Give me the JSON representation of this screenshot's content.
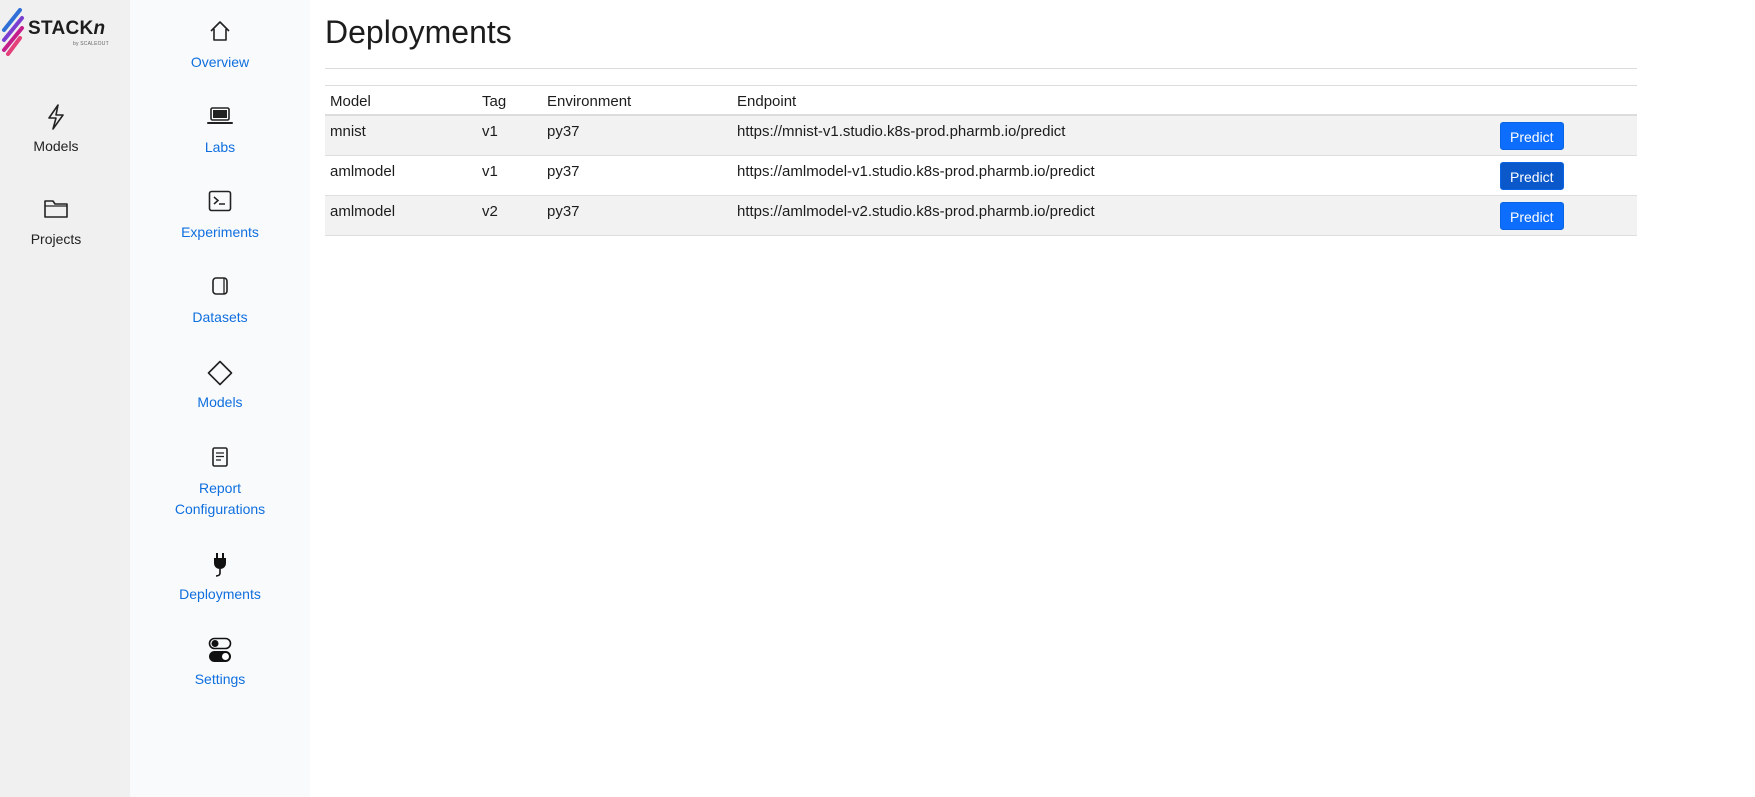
{
  "brand": {
    "name": "STACKn",
    "name_main": "STACK",
    "name_suffix": "n",
    "byline": "by SCALEOUT",
    "colors": [
      "#2f6fd6",
      "#c41e8d",
      "#e4407a"
    ]
  },
  "rail": {
    "items": [
      {
        "label": "Models",
        "icon": "lightning-icon"
      },
      {
        "label": "Projects",
        "icon": "folder-icon"
      }
    ]
  },
  "sidebar": {
    "accent": "#0f6fde",
    "items": [
      {
        "label": "Overview",
        "icon": "home-icon"
      },
      {
        "label": "Labs",
        "icon": "laptop-icon"
      },
      {
        "label": "Experiments",
        "icon": "terminal-icon"
      },
      {
        "label": "Datasets",
        "icon": "dataset-icon"
      },
      {
        "label": "Models",
        "icon": "diamond-icon"
      },
      {
        "label": "Report Configurations",
        "label_line1": "Report",
        "label_line2": "Configurations",
        "icon": "report-icon"
      },
      {
        "label": "Deployments",
        "icon": "plug-icon"
      },
      {
        "label": "Settings",
        "icon": "toggles-icon"
      }
    ]
  },
  "main": {
    "title": "Deployments",
    "table": {
      "columns": [
        "Model",
        "Tag",
        "Environment",
        "Endpoint",
        ""
      ],
      "rows": [
        {
          "model": "mnist",
          "tag": "v1",
          "environment": "py37",
          "endpoint": "https://mnist-v1.studio.k8s-prod.pharmb.io/predict",
          "action": "Predict"
        },
        {
          "model": "amlmodel",
          "tag": "v1",
          "environment": "py37",
          "endpoint": "https://amlmodel-v1.studio.k8s-prod.pharmb.io/predict",
          "action": "Predict"
        },
        {
          "model": "amlmodel",
          "tag": "v2",
          "environment": "py37",
          "endpoint": "https://amlmodel-v2.studio.k8s-prod.pharmb.io/predict",
          "action": "Predict"
        }
      ]
    },
    "button_color": "#0d6efd"
  }
}
